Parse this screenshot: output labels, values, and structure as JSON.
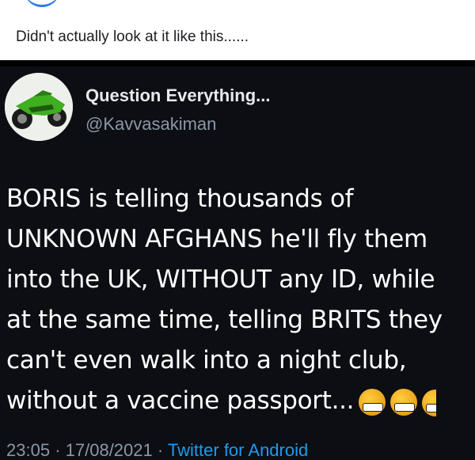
{
  "caption": "Didn't actually look at it like this......",
  "tweet": {
    "display_name": "Question Everything...",
    "handle": "@Kavvasakiman",
    "body_lines": [
      "BORIS is telling thousands of",
      "UNKNOWN AFGHANS he'll fly them",
      "into the UK, WITHOUT any ID, while",
      "at the same time, telling BRITS they",
      "can't even walk into a night club,",
      "without a vaccine passport..."
    ],
    "emoji": [
      "cursing-face-icon",
      "cursing-face-icon",
      "cursing-face-icon"
    ],
    "time": "23:05",
    "date": "17/08/2021",
    "separator": "·",
    "source": "Twitter for Android"
  }
}
